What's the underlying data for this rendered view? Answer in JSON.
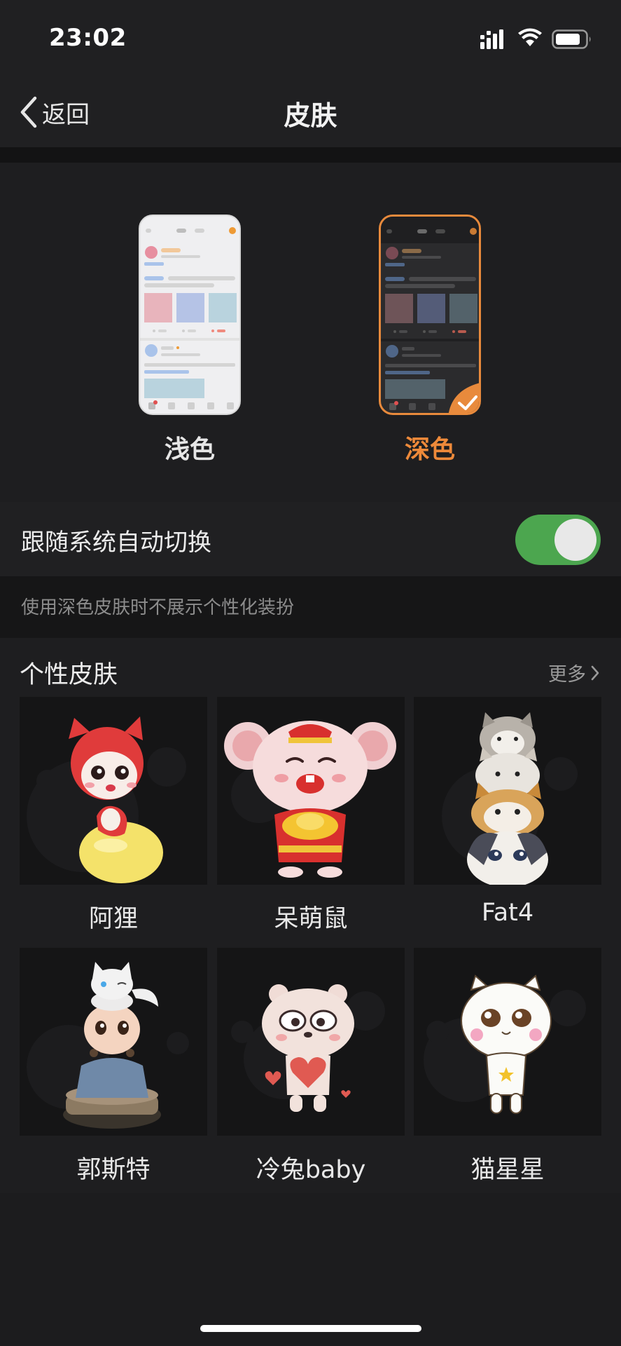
{
  "status_bar": {
    "time": "23:02",
    "icons": [
      "signal-icon",
      "wifi-icon",
      "battery-icon"
    ]
  },
  "nav": {
    "back_label": "返回",
    "title": "皮肤"
  },
  "themes": {
    "light": {
      "label": "浅色",
      "selected": false
    },
    "dark": {
      "label": "深色",
      "selected": true
    }
  },
  "follow_system": {
    "label": "跟随系统自动切换",
    "enabled": true
  },
  "hint": "使用深色皮肤时不展示个性化装扮",
  "personal_skins": {
    "title": "个性皮肤",
    "more_label": "更多",
    "items": [
      {
        "name": "阿狸",
        "icon": "ali-fox-icon"
      },
      {
        "name": "呆萌鼠",
        "icon": "mouse-icon"
      },
      {
        "name": "Fat4",
        "icon": "cats-icon"
      },
      {
        "name": "郭斯特",
        "icon": "monk-icon"
      },
      {
        "name": "冷兔baby",
        "icon": "rabbit-icon"
      },
      {
        "name": "猫星星",
        "icon": "cat-icon"
      }
    ]
  },
  "colors": {
    "accent_orange": "#ee8a3a",
    "toggle_green": "#4ca64f",
    "background": "#1c1c1e"
  }
}
